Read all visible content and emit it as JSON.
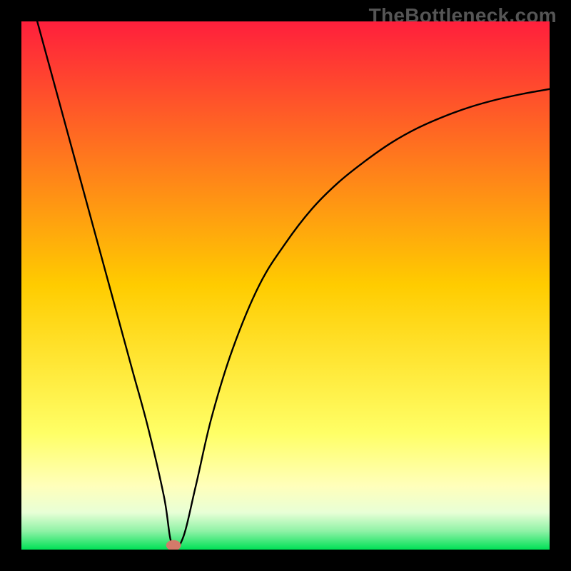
{
  "watermark": {
    "text": "TheBottleneck.com"
  },
  "chart_data": {
    "type": "line",
    "title": "",
    "xlabel": "",
    "ylabel": "",
    "xlim": [
      0,
      100
    ],
    "ylim": [
      0,
      100
    ],
    "grid": false,
    "background_gradient_stops": [
      {
        "offset": 0.0,
        "color": "#ff1f3c"
      },
      {
        "offset": 0.5,
        "color": "#ffcc00"
      },
      {
        "offset": 0.78,
        "color": "#ffff66"
      },
      {
        "offset": 0.88,
        "color": "#ffffbb"
      },
      {
        "offset": 0.93,
        "color": "#e8ffd6"
      },
      {
        "offset": 0.965,
        "color": "#8ff2a6"
      },
      {
        "offset": 1.0,
        "color": "#00e156"
      }
    ],
    "series": [
      {
        "name": "bottleneck-curve",
        "x": [
          3,
          6,
          9,
          12,
          15,
          18,
          21,
          24,
          27,
          28.5,
          30.5,
          33,
          36,
          40,
          45,
          50,
          55,
          60,
          65,
          70,
          75,
          80,
          85,
          90,
          95,
          100
        ],
        "y": [
          100,
          89,
          78,
          67,
          56,
          45,
          34,
          23,
          10,
          1,
          2,
          12,
          25,
          38,
          50,
          58,
          64.5,
          69.5,
          73.5,
          77,
          79.8,
          82,
          83.8,
          85.2,
          86.3,
          87.2
        ]
      }
    ],
    "markers": [
      {
        "name": "optimal-point",
        "x": 28.8,
        "y": 0.8,
        "color": "#d37a6a",
        "rx": 1.4,
        "ry": 1.0
      }
    ]
  }
}
